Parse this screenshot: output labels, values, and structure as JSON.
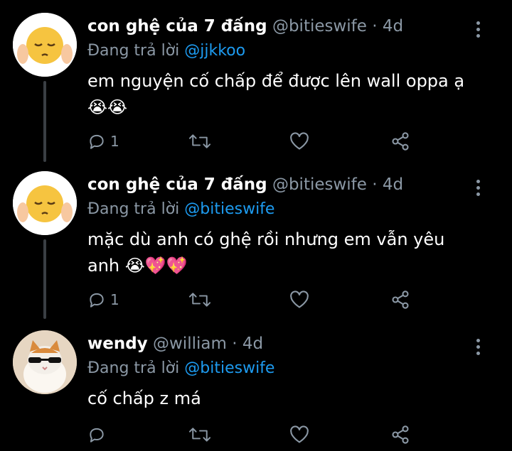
{
  "tweets": [
    {
      "name": "con ghệ của 7 đấng",
      "handle": "@bitieswife",
      "dot": "·",
      "time": "4d",
      "reply_prefix": "Đang trả lời",
      "reply_to": "@jjkkoo",
      "text": "em nguyện cố chấp để được lên wall oppa ạ\n😭😭",
      "reply_count": "1",
      "avatar": "pleading-face-emoji"
    },
    {
      "name": "con ghệ của 7 đấng",
      "handle": "@bitieswife",
      "dot": "·",
      "time": "4d",
      "reply_prefix": "Đang trả lời",
      "reply_to": "@bitieswife",
      "text": "mặc dù anh có ghệ rồi nhưng em vẫn yêu\nanh 😭💖💖",
      "reply_count": "1",
      "avatar": "pleading-face-emoji"
    },
    {
      "name": "wendy",
      "handle": "@william",
      "dot": "·",
      "time": "4d",
      "reply_prefix": "Đang trả lời",
      "reply_to": "@bitieswife",
      "text": "cố chấp z má",
      "reply_count": "",
      "avatar": "cat-with-sunglasses-photo"
    }
  ],
  "icons": {
    "reply": "reply-icon",
    "retweet": "retweet-icon",
    "like": "heart-icon",
    "share": "share-icon",
    "more": "more-options-icon"
  },
  "colors": {
    "background": "#000000",
    "muted": "#8b98a5",
    "link": "#1d9bf0",
    "thread_line": "#3a3f44"
  }
}
